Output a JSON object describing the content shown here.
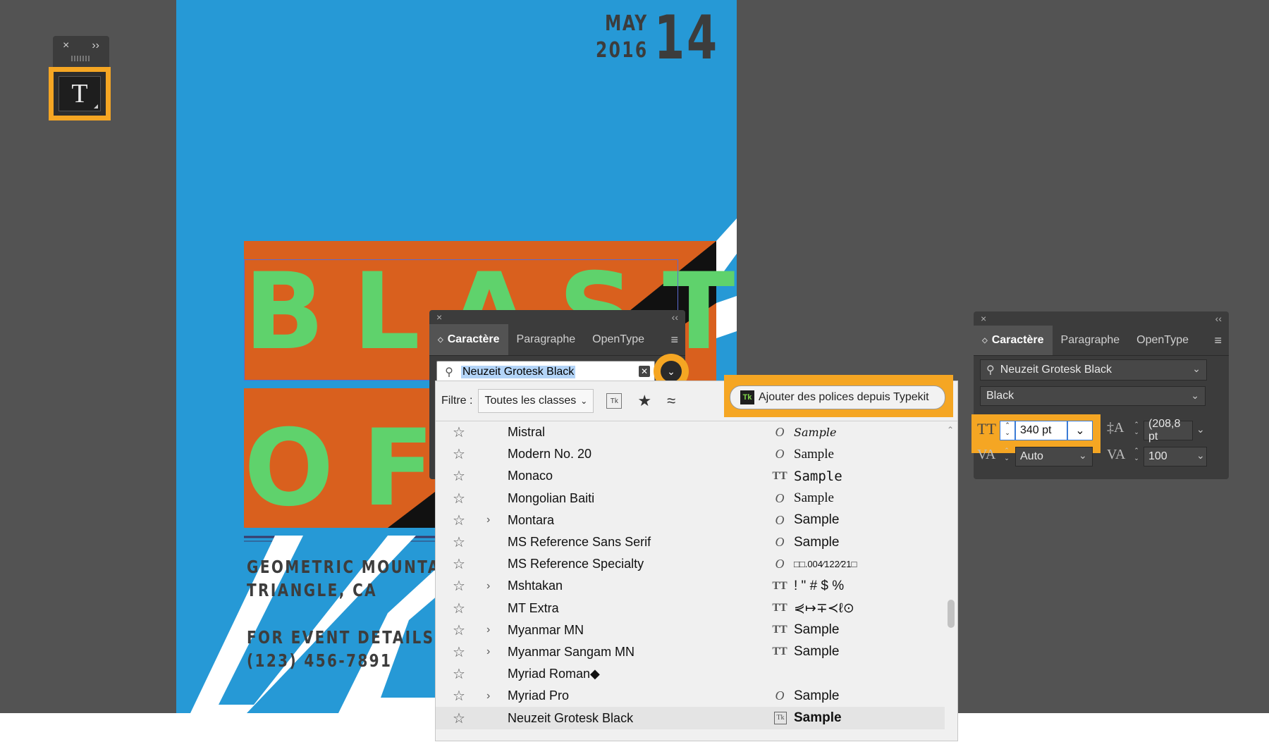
{
  "tools": {
    "close_glyph": "×",
    "expand_glyph": "››",
    "type_tool_glyph": "T"
  },
  "poster": {
    "month": "MAY",
    "year": "2016",
    "day": "14",
    "blast": "BLAST",
    "of": "OF",
    "line1": "GEOMETRIC MOUNTAIN",
    "line2": "TRIANGLE, CA",
    "line3": "FOR EVENT DETAILS CALL",
    "line4": "(123) 456-7891",
    "colors": {
      "background": "#2699d6",
      "block": "#d9601e",
      "title": "#5fd26c",
      "text": "#3d3d3d"
    }
  },
  "character_panel": {
    "tabs": [
      "Caractère",
      "Paragraphe",
      "OpenType"
    ],
    "search_value": "Neuzeit Grotesk Black",
    "clear_glyph": "✕"
  },
  "font_menu": {
    "filter_label": "Filtre :",
    "filter_value": "Toutes les classes",
    "typekit_icon": "Tk",
    "typekit_button": "Ajouter des polices depuis Typekit",
    "fonts": [
      {
        "name": "Mistral",
        "has_children": false,
        "type_icon": "O",
        "sample": "Sample"
      },
      {
        "name": "Modern No. 20",
        "has_children": false,
        "type_icon": "O",
        "sample": "Sample"
      },
      {
        "name": "Monaco",
        "has_children": false,
        "type_icon": "TT",
        "sample": "Sample"
      },
      {
        "name": "Mongolian Baiti",
        "has_children": false,
        "type_icon": "O",
        "sample": "Sample"
      },
      {
        "name": "Montara",
        "has_children": true,
        "type_icon": "O",
        "sample": "Sample"
      },
      {
        "name": "MS Reference Sans Serif",
        "has_children": false,
        "type_icon": "O",
        "sample": "Sample"
      },
      {
        "name": "MS Reference Specialty",
        "has_children": false,
        "type_icon": "O",
        "sample": "□□.004⁄122⁄21□"
      },
      {
        "name": "Mshtakan",
        "has_children": true,
        "type_icon": "TT",
        "sample": "! \" # $ %"
      },
      {
        "name": "MT Extra",
        "has_children": false,
        "type_icon": "TT",
        "sample": "⋞↦∓≺ℓ⊙"
      },
      {
        "name": "Myanmar MN",
        "has_children": true,
        "type_icon": "TT",
        "sample": "Sample"
      },
      {
        "name": "Myanmar Sangam MN",
        "has_children": true,
        "type_icon": "TT",
        "sample": "Sample"
      },
      {
        "name": "Myriad Roman◆",
        "has_children": false,
        "type_icon": "",
        "sample": ""
      },
      {
        "name": "Myriad Pro",
        "has_children": true,
        "type_icon": "O",
        "sample": "Sample"
      },
      {
        "name": "Neuzeit Grotesk Black",
        "has_children": false,
        "type_icon": "Tk",
        "sample": "Sample",
        "selected": true
      }
    ]
  },
  "right_panel": {
    "tabs": [
      "Caractère",
      "Paragraphe",
      "OpenType"
    ],
    "font_family": "Neuzeit Grotesk Black",
    "font_style": "Black",
    "font_size": "340 pt",
    "leading": "(208,8 pt",
    "kerning": "Auto",
    "tracking": "100"
  },
  "accent": "#f5a623"
}
